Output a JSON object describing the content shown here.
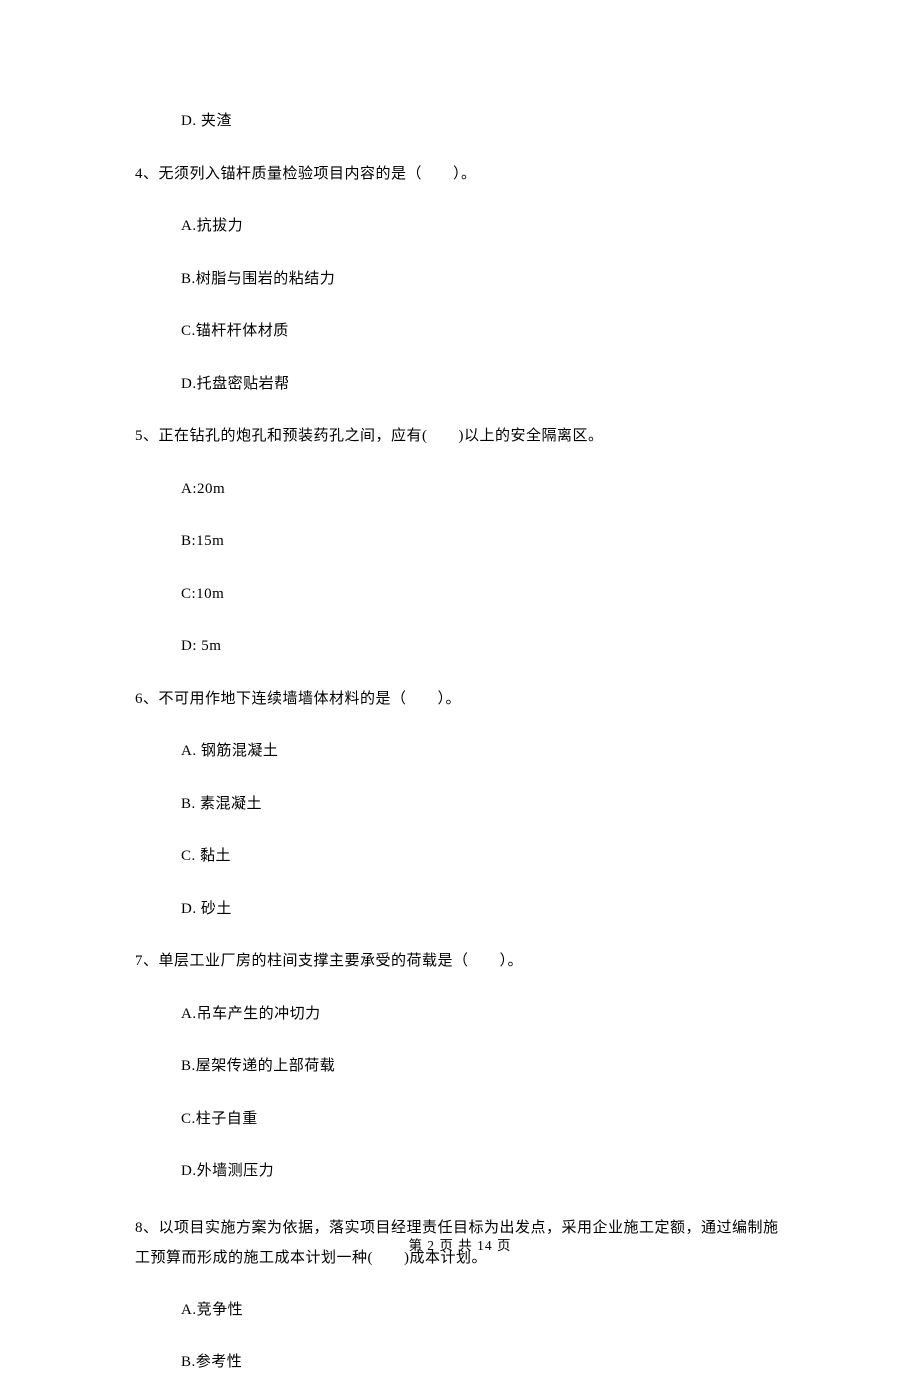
{
  "q3": {
    "optD": "D. 夹渣"
  },
  "q4": {
    "stem": "4、无须列入锚杆质量检验项目内容的是（　　）。",
    "optA": "A.抗拔力",
    "optB": "B.树脂与围岩的粘结力",
    "optC": "C.锚杆杆体材质",
    "optD": "D.托盘密贴岩帮"
  },
  "q5": {
    "stem": "5、正在钻孔的炮孔和预装药孔之间，应有(　　)以上的安全隔离区。",
    "optA": "A:20m",
    "optB": "B:15m",
    "optC": "C:10m",
    "optD": "D: 5m"
  },
  "q6": {
    "stem": "6、不可用作地下连续墙墙体材料的是（　　）。",
    "optA": "A. 钢筋混凝土",
    "optB": "B. 素混凝土",
    "optC": "C. 黏土",
    "optD": "D. 砂土"
  },
  "q7": {
    "stem": "7、单层工业厂房的柱间支撑主要承受的荷载是（　　）。",
    "optA": "A.吊车产生的冲切力",
    "optB": "B.屋架传递的上部荷载",
    "optC": "C.柱子自重",
    "optD": "D.外墙测压力"
  },
  "q8": {
    "stem": "8、以项目实施方案为依据，落实项目经理责任目标为出发点，采用企业施工定额，通过编制施工预算而形成的施工成本计划一种(　　)成本计划。",
    "optA": "A.竞争性",
    "optB": "B.参考性"
  },
  "footer": "第 2 页 共 14 页"
}
